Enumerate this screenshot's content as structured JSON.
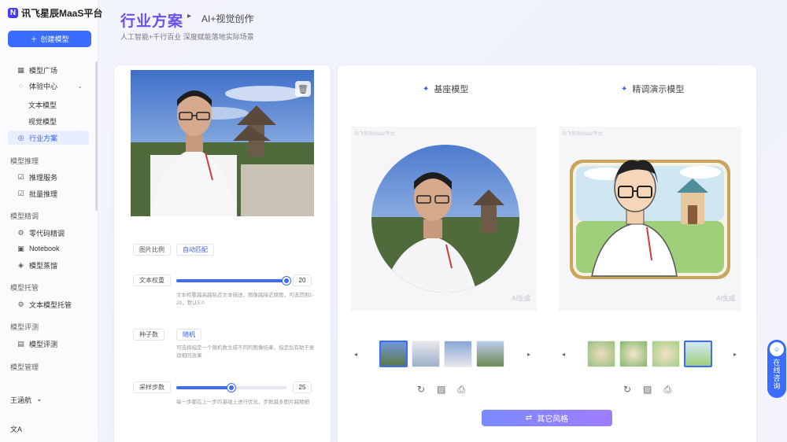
{
  "app": {
    "logo_mark": "N",
    "name": "讯飞星辰MaaS平台",
    "create_label": "创建模型"
  },
  "sidebar": {
    "items": [
      {
        "label": "模型广场",
        "icon": "grid-icon"
      },
      {
        "label": "体验中心",
        "icon": "circle-icon"
      },
      {
        "label": "文本模型"
      },
      {
        "label": "视觉模型"
      },
      {
        "label": "行业方案",
        "icon": "circle-icon"
      }
    ],
    "groups": [
      {
        "label": "模型推理",
        "items": [
          "推理服务",
          "批量推理"
        ]
      },
      {
        "label": "模型精调",
        "items": [
          "零代码精调",
          "Notebook",
          "模型蒸馏"
        ]
      },
      {
        "label": "模型托管",
        "items": [
          "文本模型托管"
        ]
      },
      {
        "label": "模型评测",
        "items": [
          "模型评测"
        ]
      },
      {
        "label": "模型管理",
        "items": []
      }
    ],
    "user": "王涵航",
    "lang": "文A"
  },
  "header": {
    "title": "行业方案",
    "crumb": "AI+视觉创作",
    "subtitle": "人工智能+千行百业 深度赋能落地实际场景"
  },
  "params": {
    "ratio_label": "图片比例",
    "ratio_value": "自动匹配",
    "text_weight_label": "文本权重",
    "text_weight_value": 20,
    "text_weight_max": 20,
    "text_weight_desc": "文本权重越高越贴近文本描述，图像越接近原图，可选范围1-20，默认5.0",
    "seed_label": "种子数",
    "seed_value": "随机",
    "seed_desc": "可选择指定一个随机数生成不同的图像结果，指定后有助于复现相同效果",
    "steps_label": "采样步数",
    "steps_value": 25,
    "steps_max": 50,
    "steps_desc": "每一步都在上一步的基础上进行优化，步数越多图片越精细"
  },
  "columns": {
    "base": {
      "title": "基座模型",
      "watermark": "讯飞星辰MaaS平台",
      "ai_tag": "AI生成"
    },
    "tuned": {
      "title": "精调演示模型",
      "watermark": "讯飞星辰MaaS平台",
      "ai_tag": "AI生成"
    }
  },
  "actions": {
    "other_style": "其它风格"
  },
  "consult": {
    "label": "在线咨询"
  },
  "colors": {
    "accent": "#3a6cff",
    "title": "#6a50e8"
  }
}
